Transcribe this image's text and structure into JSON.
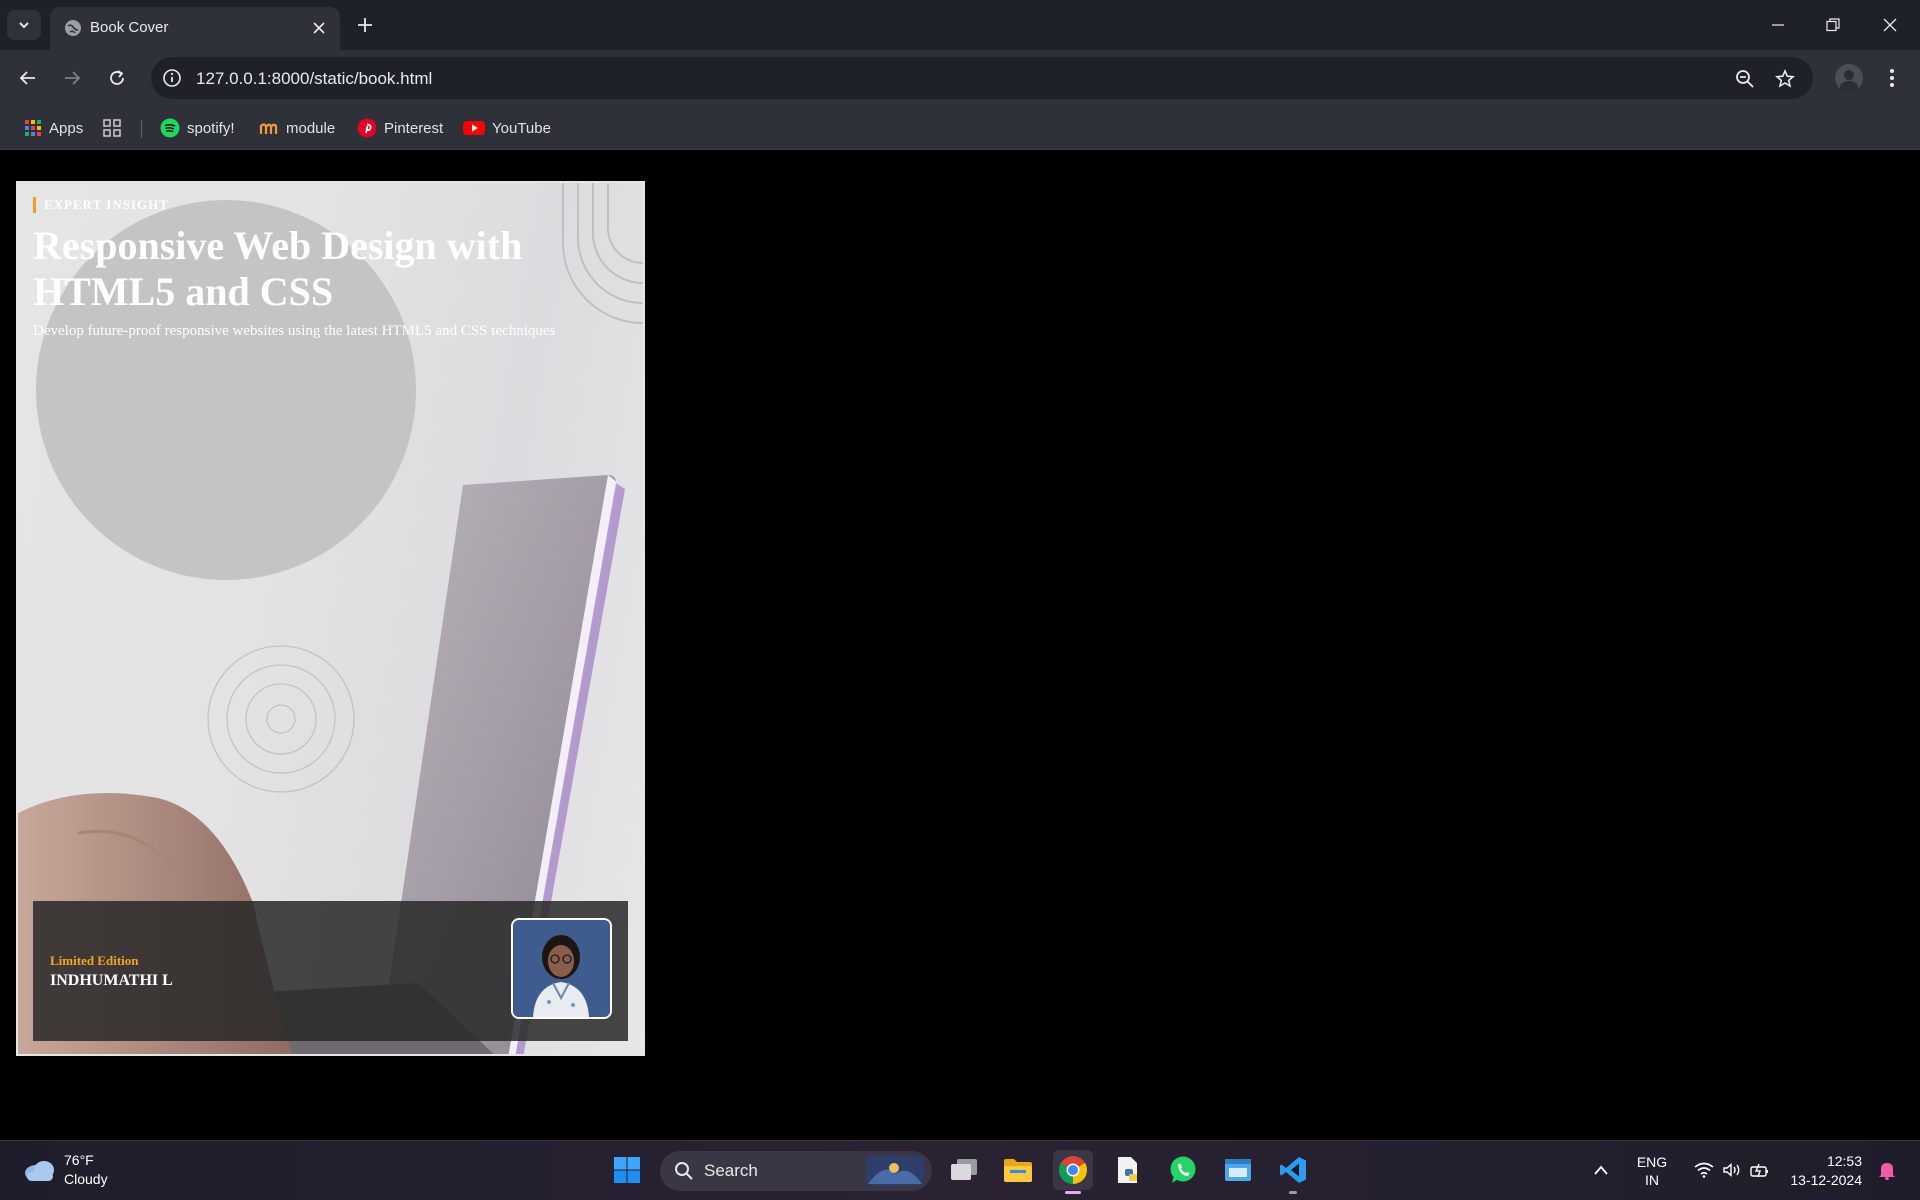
{
  "browser": {
    "tab": {
      "title": "Book Cover"
    },
    "address": {
      "url": "127.0.0.1:8000/static/book.html"
    },
    "bookmarks": [
      {
        "label": "Apps",
        "icon": "apps-grid-icon"
      },
      {
        "label": "",
        "icon": "tab-groups-icon"
      },
      {
        "label": "spotify!",
        "icon": "spotify-icon"
      },
      {
        "label": "module",
        "icon": "module-icon"
      },
      {
        "label": "Pinterest",
        "icon": "pinterest-icon"
      },
      {
        "label": "YouTube",
        "icon": "youtube-icon"
      }
    ]
  },
  "cover": {
    "badge": "EXPERT INSIGHT",
    "title": "Responsive Web Design with HTML5 and CSS",
    "subtitle": "Develop future-proof responsive websites using the latest HTML5 and CSS techniques",
    "edition": "Limited Edition",
    "author": "INDHUMATHI L",
    "accent_color": "#f5a623"
  },
  "taskbar": {
    "weather": {
      "temp": "76°F",
      "condition": "Cloudy"
    },
    "search_label": "Search",
    "language": {
      "line1": "ENG",
      "line2": "IN"
    },
    "clock": {
      "time": "12:53",
      "date": "13-12-2024"
    }
  }
}
